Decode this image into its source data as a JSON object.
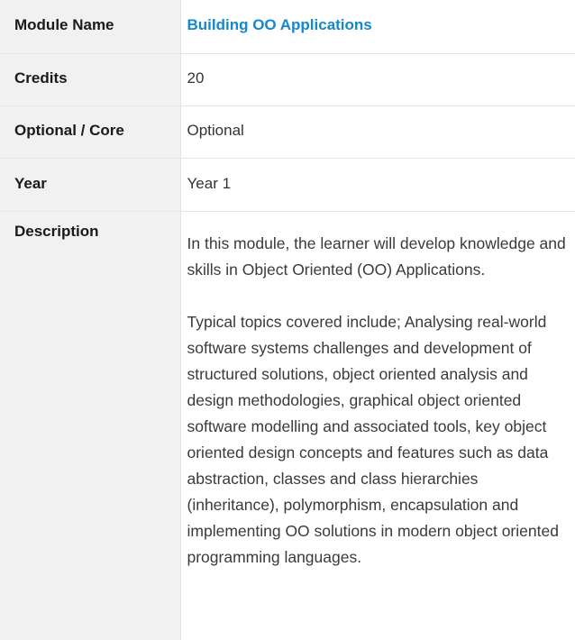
{
  "rows": {
    "module_name": {
      "label": "Module Name",
      "value": "Building  OO Applications"
    },
    "credits": {
      "label": "Credits",
      "value": "20"
    },
    "optional_core": {
      "label": "Optional / Core",
      "value": "Optional"
    },
    "year": {
      "label": "Year",
      "value": "Year 1"
    },
    "description": {
      "label": "Description",
      "paragraphs": [
        "In this module, the learner will develop knowledge and skills in Object Oriented (OO) Applications.",
        "Typical topics covered include; Analysing real-world software systems challenges and development of structured solutions, object oriented analysis and design methodologies, graphical object oriented software modelling and associated tools, key object oriented design concepts and features such as data abstraction, classes and class hierarchies (inheritance), polymorphism, encapsulation  and implementing OO solutions in modern object oriented programming languages."
      ]
    }
  },
  "colors": {
    "label_background": "#f1f1f1",
    "module_title": "#1588c8",
    "row_border": "#e6e6e6"
  }
}
